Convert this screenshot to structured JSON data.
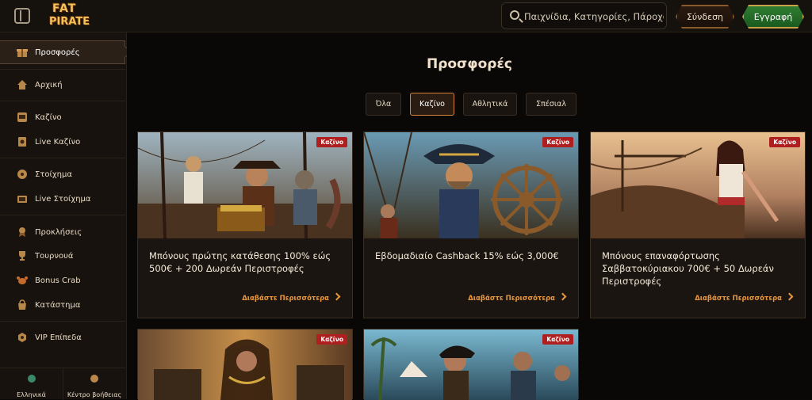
{
  "header": {
    "logo_line1": "FAT",
    "logo_line2": "PIRATE",
    "search_placeholder": "Παιχνίδια, Κατηγορίες, Πάροχοι",
    "login_label": "Σύνδεση",
    "register_label": "Εγγραφή"
  },
  "sidebar": {
    "items": [
      {
        "label": "Προσφορές",
        "icon": "gift-icon",
        "active": true
      },
      {
        "label": "Αρχική",
        "icon": "home-icon"
      },
      {
        "label": "Καζίνο",
        "icon": "casino-icon"
      },
      {
        "label": "Live Καζίνο",
        "icon": "live-casino-icon"
      },
      {
        "label": "Στοίχημα",
        "icon": "sports-icon"
      },
      {
        "label": "Live Στοίχημα",
        "icon": "live-sports-icon"
      },
      {
        "label": "Προκλήσεις",
        "icon": "challenges-icon"
      },
      {
        "label": "Τουρνουά",
        "icon": "trophy-icon"
      },
      {
        "label": "Bonus Crab",
        "icon": "crab-icon"
      },
      {
        "label": "Κατάστημα",
        "icon": "shop-icon"
      },
      {
        "label": "VIP Επίπεδα",
        "icon": "vip-icon"
      }
    ],
    "bottom": {
      "language_label": "Ελληνικά",
      "help_label": "Κέντρο βοήθειας"
    }
  },
  "main": {
    "title": "Προσφορές",
    "filters": [
      {
        "label": "Όλα"
      },
      {
        "label": "Καζίνο",
        "active": true
      },
      {
        "label": "Αθλητικά"
      },
      {
        "label": "Σπέσιαλ"
      }
    ],
    "cards": [
      {
        "badge": "Καζίνο",
        "title": "Μπόνους πρώτης κατάθεσης 100% εώς 500€ + 200 Δωρεάν Περιστροφές",
        "link": "Διαβάστε Περισσότερα"
      },
      {
        "badge": "Καζίνο",
        "title": "Εβδομαδιαίο Cashback 15% εώς 3,000€",
        "link": "Διαβάστε Περισσότερα"
      },
      {
        "badge": "Καζίνο",
        "title": "Μπόνους επαναφόρτωσης Σαββατοκύριακου 700€ + 50 Δωρεάν Περιστροφές",
        "link": "Διαβάστε Περισσότερα"
      },
      {
        "badge": "Καζίνο"
      },
      {
        "badge": "Καζίνο"
      }
    ]
  }
}
